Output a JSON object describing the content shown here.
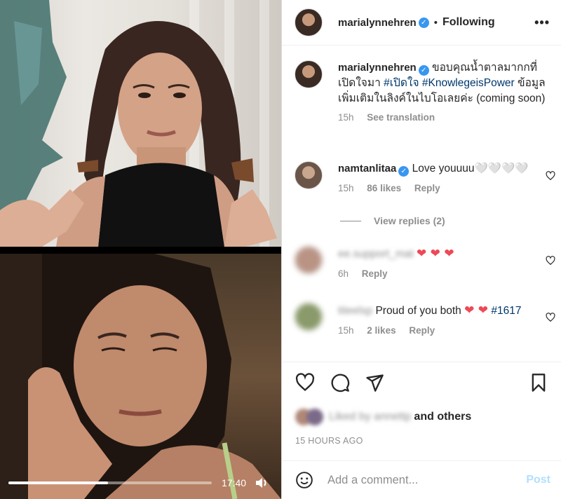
{
  "header": {
    "username": "marialynnehren",
    "verified_mark": "✓",
    "separator": "•",
    "follow_status": "Following",
    "more": "•••"
  },
  "caption": {
    "username": "marialynnehren",
    "text_1": "ขอบคุณน้ำตาลมากกที่เปิดใจมา",
    "hashtag_1": "#เปิดใจ",
    "hashtag_2": "#KnowlegeisPower",
    "text_2": "ข้อมูลเพิ่มเติมในลิงค์ในไบโอเลยค่ะ (coming soon)",
    "time": "15h",
    "see_translation": "See translation"
  },
  "comments": [
    {
      "username": "namtanlitaa",
      "text": "Love youuuu🤍🤍🤍🤍",
      "time": "15h",
      "likes": "86 likes",
      "reply": "Reply",
      "view_replies": "View replies (2)"
    },
    {
      "username": "ee.support_mat",
      "hearts": "❤ ❤ ❤",
      "time": "6h",
      "reply": "Reply"
    },
    {
      "username": "titeelsp",
      "text": "Proud of you both",
      "hearts": "❤ ❤",
      "hashtag": "#1617",
      "time": "15h",
      "likes": "2 likes",
      "reply": "Reply"
    }
  ],
  "likes": {
    "liked_by": "Liked by annettp",
    "others": "and others"
  },
  "timestamp": "15 HOURS AGO",
  "add_comment": {
    "placeholder": "Add a comment...",
    "post": "Post"
  },
  "video": {
    "time": "17:40",
    "progress": 0.49
  },
  "icons": {
    "like": "heart-icon",
    "comment": "comment-icon",
    "share": "share-icon",
    "save": "bookmark-icon",
    "emoji": "emoji-icon",
    "volume": "volume-icon"
  },
  "colors": {
    "verified": "#3897f0",
    "heart_red": "#ed4956",
    "hashtag": "#00376b",
    "post_disabled": "#b2dffc"
  }
}
